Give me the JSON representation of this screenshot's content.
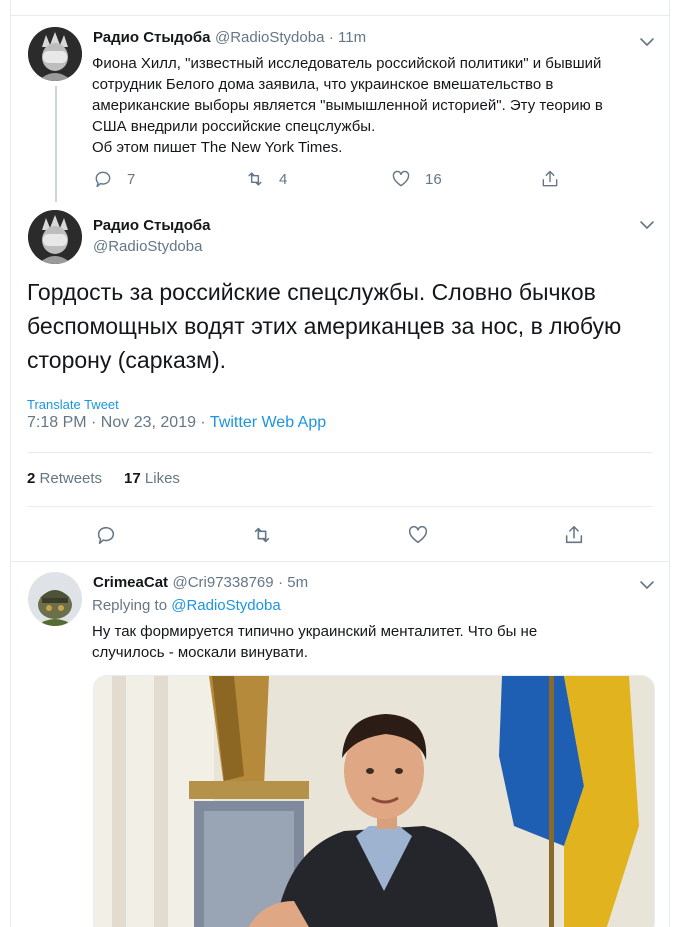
{
  "tweet1": {
    "name": "Радио Стыдоба",
    "handle": "@RadioStydoba",
    "time": "· 11m",
    "text": "Фиона Хилл, \"известный исследователь российской политики\" и бывший\nсотрудник Белого дома заявила, что украинское вмешательство в\nамериканские выборы является \"вымышленной историей\". Эту теорию в\nСША внедрили российские спецслужбы.\nОб этом пишет The New York Times.",
    "replies": "7",
    "retweets": "4",
    "likes": "16"
  },
  "main_tweet": {
    "name": "Радио Стыдоба",
    "handle": "@RadioStydoba",
    "text": "Гордость за российские спецслужбы. Словно бычков беспомощных водят этих американцев за нос, в любую сторону (сарказм).",
    "translate_label": "Translate Tweet",
    "timestamp": "7:18 PM · Nov 23, 2019 · ",
    "app": "Twitter Web App",
    "retweet_count": "2",
    "retweet_label": "Retweets",
    "like_count": "17",
    "like_label": "Likes"
  },
  "reply": {
    "name": "CrimeaCat",
    "handle": "@Cri97338769",
    "time": "· 5m",
    "replying_to_label": "Replying to",
    "replying_to_handle": "@RadioStydoba",
    "text": "Ну так формируется типично украинский менталитет. Что бы не\nслучилось - москали винувати."
  },
  "icons": {
    "reply": "reply-icon",
    "retweet": "retweet-icon",
    "like": "heart-icon",
    "share": "share-icon",
    "more": "chevron-down-icon"
  },
  "colors": {
    "link": "#1b95e0",
    "secondary": "#657786",
    "text": "#14171a",
    "border": "#e6ecf0"
  }
}
